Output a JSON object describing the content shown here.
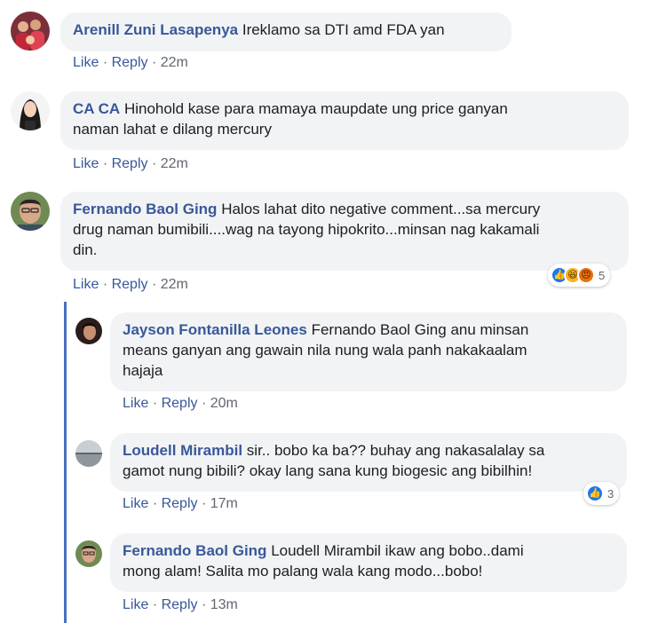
{
  "comments": [
    {
      "author": "Arenill Zuni Lasapenya",
      "text": "Ireklamo sa DTI amd FDA yan",
      "like": "Like",
      "reply": "Reply",
      "time": "22m"
    },
    {
      "author": "CA CA",
      "text_line1": "Hinohold kase para mamaya maupdate ung price ganyan",
      "text_line2": "naman lahat e dilang mercury",
      "like": "Like",
      "reply": "Reply",
      "time": "22m"
    },
    {
      "author": "Fernando Baol Ging",
      "text_line1": "Halos lahat dito negative comment...sa mercury",
      "text_line2": "drug naman bumibili....wag na tayong hipokrito...minsan nag kakamali",
      "text_line3": "din.",
      "like": "Like",
      "reply": "Reply",
      "time": "22m",
      "reaction_count": "5",
      "reactions": [
        "like-icon",
        "haha-icon",
        "angry-icon"
      ]
    }
  ],
  "replies": [
    {
      "author": "Jayson Fontanilla Leones",
      "text_line1": "Fernando Baol Ging anu minsan",
      "text_line2": "means ganyan ang gawain nila nung wala panh nakakaalam",
      "text_line3": "hajaja",
      "like": "Like",
      "reply": "Reply",
      "time": "20m"
    },
    {
      "author": "Loudell Mirambil",
      "text_line1": "sir.. bobo ka ba?? buhay ang nakasalalay sa",
      "text_line2": "gamot nung bibili? okay lang sana kung biogesic ang bibilhin!",
      "like": "Like",
      "reply": "Reply",
      "time": "17m",
      "reaction_count": "3",
      "reactions": [
        "like-icon"
      ]
    },
    {
      "author": "Fernando Baol Ging",
      "text_line1": "Loudell Mirambil ikaw ang bobo..dami",
      "text_line2": "mong alam! Salita mo palang wala kang modo...bobo!",
      "like": "Like",
      "reply": "Reply",
      "time": "13m"
    }
  ],
  "separator": "·",
  "colors": {
    "author": "#385898",
    "bubble": "#f2f3f5",
    "meta": "#616770",
    "thread_line": "#4b6fbd",
    "like_reaction": "#1877f2"
  }
}
